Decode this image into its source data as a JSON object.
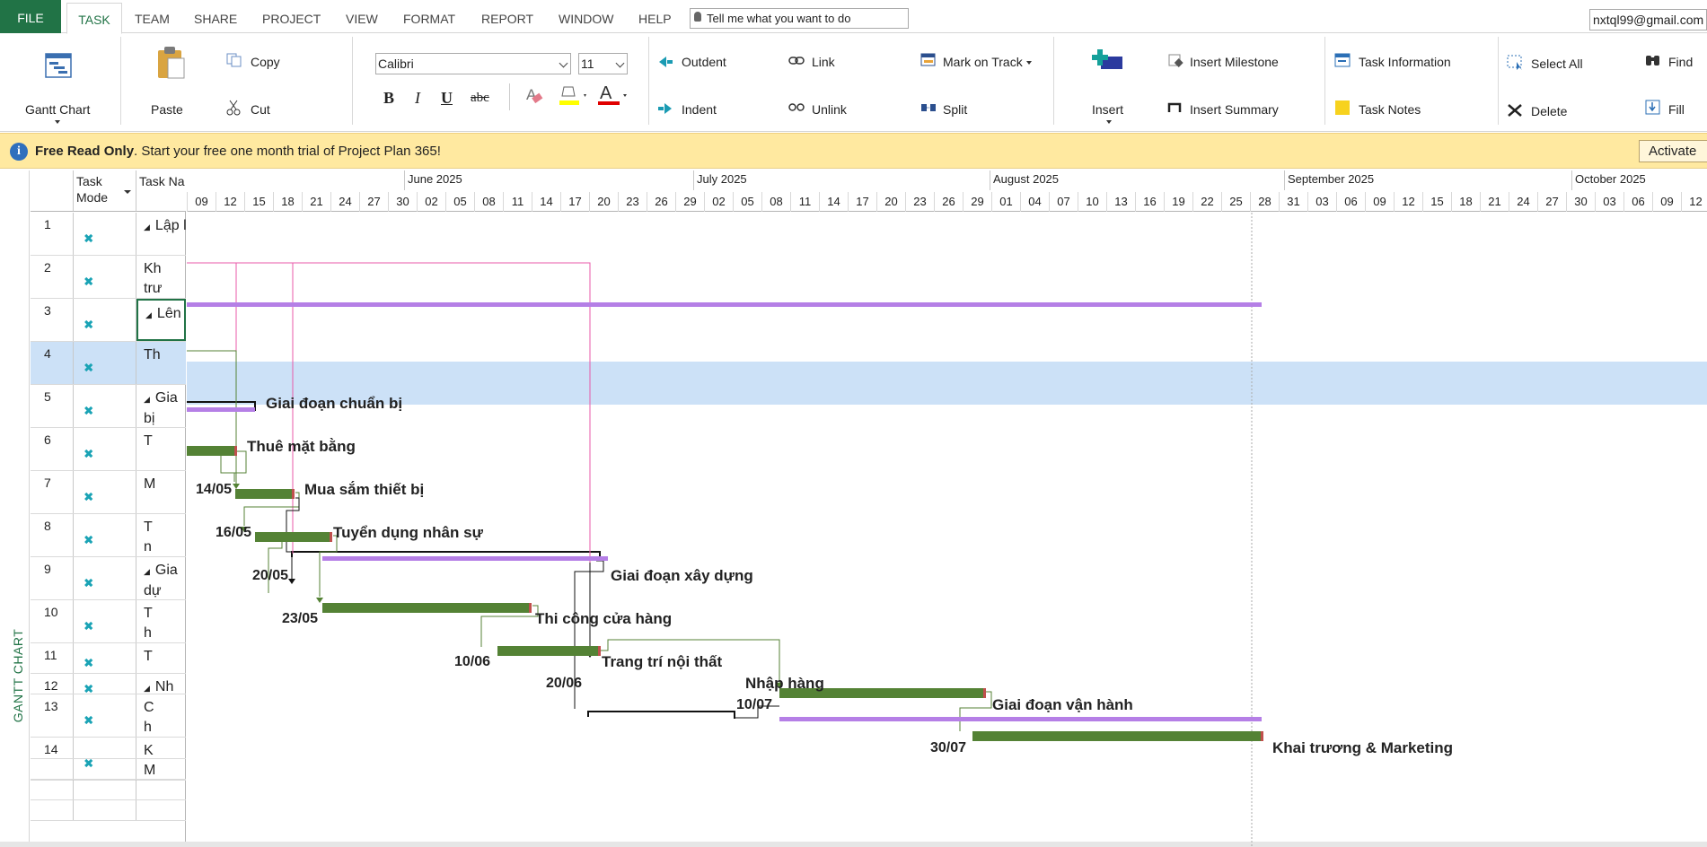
{
  "tabs": {
    "file": "FILE",
    "task": "TASK",
    "team": "TEAM",
    "share": "SHARE",
    "project": "PROJECT",
    "view": "VIEW",
    "format": "FORMAT",
    "report": "REPORT",
    "window": "WINDOW",
    "help": "HELP"
  },
  "tell_me": "Tell me what you want to do",
  "account": "nxtql99@gmail.com",
  "ribbon": {
    "gantt_chart": "Gantt Chart",
    "paste": "Paste",
    "copy": "Copy",
    "cut": "Cut",
    "font_name": "Calibri",
    "font_size": "11",
    "bold": "B",
    "italic": "I",
    "underline": "U",
    "strike": "abc",
    "outdent": "Outdent",
    "indent": "Indent",
    "link": "Link",
    "unlink": "Unlink",
    "mark_on_track": "Mark on Track",
    "split": "Split",
    "insert": "Insert",
    "insert_milestone": "Insert Milestone",
    "insert_summary": "Insert Summary",
    "task_information": "Task Information",
    "task_notes": "Task Notes",
    "select_all": "Select All",
    "delete": "Delete",
    "find": "Find",
    "fill": "Fill"
  },
  "infobar": {
    "bold": "Free Read Only",
    "text": ". Start your free one month trial of Project Plan 365!",
    "activate": "Activate"
  },
  "side_label": "GANTT CHART",
  "table": {
    "col_mode": "Task Mode",
    "col_name": "Task Na",
    "rows": [
      {
        "id": "1",
        "name": "Lập l",
        "summary": true
      },
      {
        "id": "2",
        "name": "Kh",
        "name2": "trư"
      },
      {
        "id": "3",
        "name": "Lên v",
        "summary": true
      },
      {
        "id": "4",
        "name": "Th"
      },
      {
        "id": "5",
        "name": "Gia",
        "name2": "bị",
        "summary": true
      },
      {
        "id": "6",
        "name": "T"
      },
      {
        "id": "7",
        "name": "M"
      },
      {
        "id": "8",
        "name": "T",
        "name2": "n"
      },
      {
        "id": "9",
        "name": "Gia",
        "name2": "dự",
        "summary": true
      },
      {
        "id": "10",
        "name": "T",
        "name2": "h"
      },
      {
        "id": "11",
        "name": "T"
      },
      {
        "id": "12",
        "name": "Nh",
        "summary": true
      },
      {
        "id": "13",
        "name": "C",
        "name2": "h"
      },
      {
        "id": "14",
        "name": "K",
        "name2": "M"
      }
    ]
  },
  "timeline": {
    "months": [
      "June 2025",
      "July 2025",
      "August 2025",
      "September 2025",
      "October 2025"
    ],
    "days": [
      "09",
      "12",
      "15",
      "18",
      "21",
      "24",
      "27",
      "30",
      "02",
      "05",
      "08",
      "11",
      "14",
      "17",
      "20",
      "23",
      "26",
      "29",
      "02",
      "05",
      "08",
      "11",
      "14",
      "17",
      "20",
      "23",
      "26",
      "29",
      "01",
      "04",
      "07",
      "10",
      "13",
      "16",
      "19",
      "22",
      "25",
      "28",
      "31",
      "03",
      "06",
      "09",
      "12",
      "15",
      "18",
      "21",
      "24",
      "27",
      "30",
      "03",
      "06",
      "09",
      "12"
    ]
  },
  "gantt": {
    "labels": {
      "t5": "Giai đoạn chuẩn bị",
      "t6": "Thuê mặt bằng",
      "t7": "Mua sắm thiết bị",
      "t8": "Tuyển dụng nhân sự",
      "t9": "Giai đoạn xây dựng",
      "t10": "Thi công cửa hàng",
      "t11": "Trang trí nội thất",
      "t12": "Nhập hàng",
      "t13": "Giai đoạn vận hành",
      "t14": "Khai trương & Marketing"
    },
    "dates": {
      "t7": "14/05",
      "t8": "16/05",
      "t9": "20/05",
      "t10": "23/05",
      "t11": "10/06",
      "t12": "20/06",
      "t13": "10/07",
      "t14": "30/07"
    }
  },
  "colors": {
    "accent": "#217346",
    "task_bar": "#548235",
    "summary_bar": "#b57fe6",
    "selected_row": "#cce1f7",
    "link_line": "#e85aa8"
  }
}
